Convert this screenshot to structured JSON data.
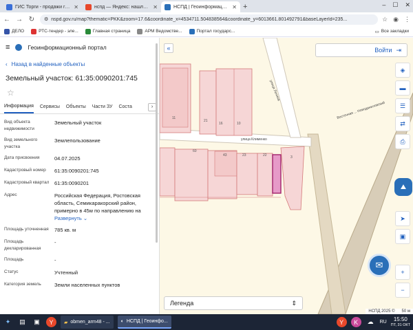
{
  "browser": {
    "tabs": [
      {
        "label": "ГИС Торги - продажи госуд...",
        "active": false,
        "favicon_color": "#3a6fd8"
      },
      {
        "label": "нспд — Яндекс: нашлось...",
        "active": false,
        "favicon_color": "#e8482b"
      },
      {
        "label": "НСПД | Геоинформационн...",
        "active": true,
        "favicon_color": "#2a6fb8"
      }
    ],
    "new_tab": "+",
    "url": "nspd.gov.ru/map?thematic=PKK&zoom=17.6&coordinate_x=4534711.504838564&coordinate_y=6013661.801492791&baseLayerId=235...",
    "bookmarks": [
      {
        "label": "ДЕЛО",
        "color": "#3554a8"
      },
      {
        "label": "РТС-тендер - эле...",
        "color": "#d33"
      },
      {
        "label": "Главная страница",
        "color": "#2a8a3a"
      },
      {
        "label": "АРМ Ведомстве...",
        "color": "#888"
      },
      {
        "label": "Портал государс...",
        "color": "#2a6fb8"
      }
    ],
    "bookmarks_all": "Все закладки"
  },
  "panel": {
    "portal_title": "Геоинформационный портал",
    "back_link": "Назад в найденные объекты",
    "object_title": "Земельный участок: 61:35:0090201:745",
    "tabs": [
      "Информация",
      "Сервисы",
      "Объекты",
      "Части ЗУ",
      "Соста"
    ],
    "properties": [
      {
        "key": "Вид объекта недвижимости",
        "value": "Земельный участок"
      },
      {
        "key": "Вид земельного участка",
        "value": "Землепользование"
      },
      {
        "key": "Дата присвоения",
        "value": "04.07.2025"
      },
      {
        "key": "Кадастровый номер",
        "value": "61:35:0090201:745"
      },
      {
        "key": "Кадастровый квартал",
        "value": "61:35:0090201"
      },
      {
        "key": "Адрес",
        "value": "Российская Федерация, Ростовская область, Семикаракорский район, примерно в 45м по направлению на"
      },
      {
        "key": "Площадь уточненная",
        "value": "785 кв. м"
      },
      {
        "key": "Площадь декларированная",
        "value": "-"
      },
      {
        "key": "Площадь",
        "value": "-"
      },
      {
        "key": "Статус",
        "value": "Учтенный"
      },
      {
        "key": "Категория земель",
        "value": "Земли населенных пунктов"
      }
    ],
    "expand_label": "Развернуть"
  },
  "map": {
    "login_label": "Войти",
    "legend_label": "Легенда",
    "street_labels": [
      "улица Ленина",
      "улица Клименко",
      "Восточная ... Новоданиловский"
    ],
    "parcel_numbers": [
      "11",
      "21",
      "16",
      "10",
      "60",
      "43",
      "23",
      "22",
      "3"
    ],
    "scale_text": "НСПД 2025 ©",
    "scale_distance": "50 м"
  },
  "taskbar": {
    "windows": [
      {
        "label": "obmen_arm48 - ...",
        "active": false
      },
      {
        "label": "НСПД | Геоинфо...",
        "active": true
      }
    ],
    "lang": "RU",
    "time": "15:50",
    "date": "ПТ, 31 ОКТ"
  }
}
